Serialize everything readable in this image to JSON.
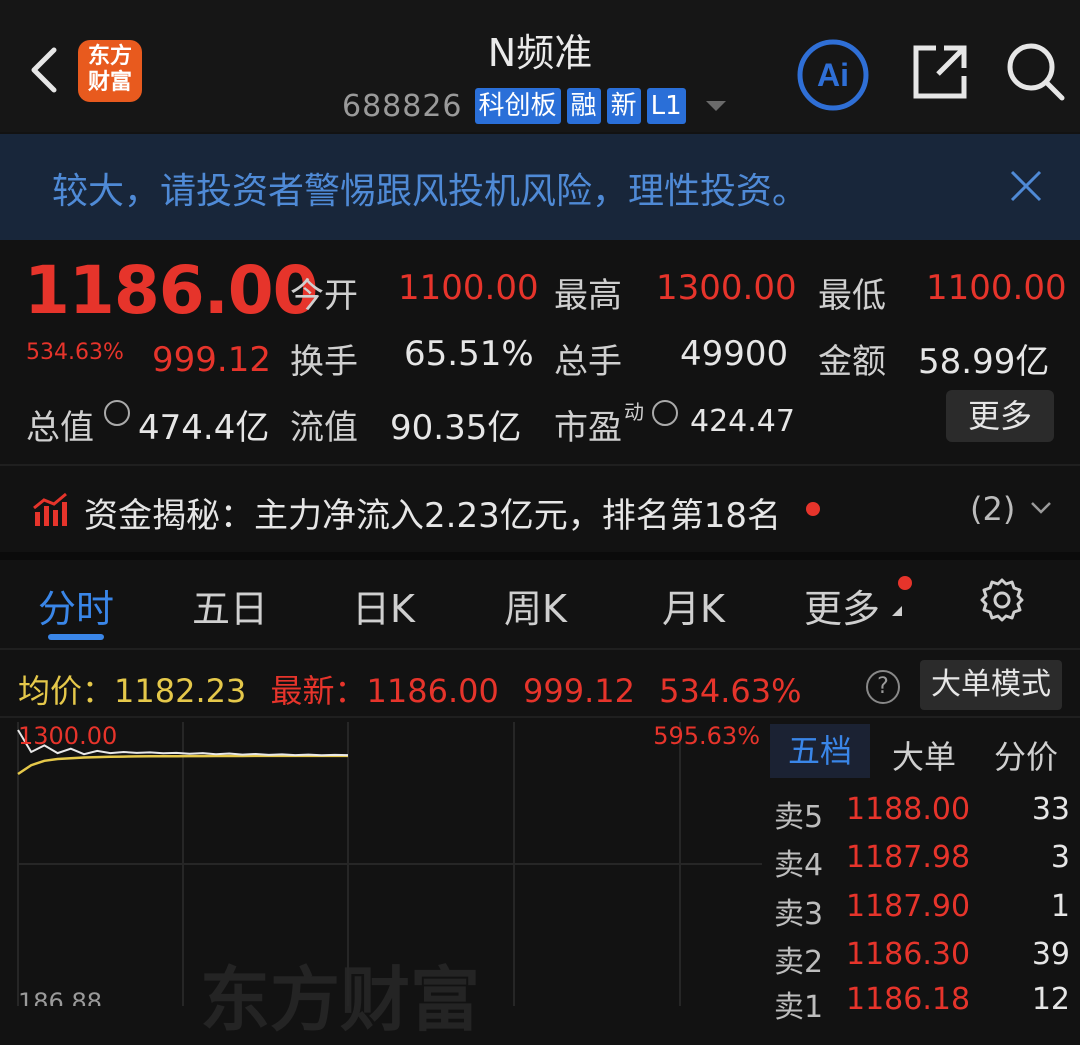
{
  "header": {
    "logo_line1": "东方",
    "logo_line2": "财富",
    "title": "N频准",
    "code": "688826",
    "tags": [
      "科创板",
      "融",
      "新",
      "L1"
    ],
    "ai_label": "Ai"
  },
  "banner": {
    "text": "较大，请投资者警惕跟风投机风险，理性投资。"
  },
  "quote": {
    "price": "1186.00",
    "pct": "534.63%",
    "change": "999.12",
    "open_label": "今开",
    "open_value": "1100.00",
    "high_label": "最高",
    "high_value": "1300.00",
    "low_label": "最低",
    "low_value": "1100.00",
    "turnover_label": "换手",
    "turnover_value": "65.51%",
    "volume_label": "总手",
    "volume_value": "49900",
    "amount_label": "金额",
    "amount_value": "58.99亿",
    "mktcap_label": "总值",
    "mktcap_value": "474.4亿",
    "float_label": "流值",
    "float_value": "90.35亿",
    "pe_label": "市盈",
    "pe_sup": "动",
    "pe_value": "424.47",
    "more_label": "更多"
  },
  "fund": {
    "text": "资金揭秘：主力净流入2.23亿元，排名第18名",
    "count": "(2)"
  },
  "tabs": [
    "分时",
    "五日",
    "日K",
    "周K",
    "月K",
    "更多"
  ],
  "avg_row": {
    "avg_label": "均价：",
    "avg_value": "1182.23",
    "latest_label": "最新：",
    "latest_price": "1186.00",
    "latest_change": "999.12",
    "latest_pct": "534.63%",
    "help": "?",
    "mode_label": "大单模式"
  },
  "chart_data": {
    "type": "line",
    "y_top_label": "1300.00",
    "y_bottom_label": "186.88",
    "pct_top_label": "595.63%",
    "ylim": [
      186.88,
      1300.0
    ],
    "series": [
      {
        "values": [
          1300,
          1200,
          1230,
          1195,
          1215,
          1190,
          1205,
          1195,
          1200,
          1196,
          1198,
          1194,
          1196,
          1192,
          1195,
          1190,
          1193,
          1188,
          1191,
          1187,
          1189,
          1186,
          1188,
          1185,
          1187,
          1186
        ]
      },
      {
        "values": [
          1100,
          1140,
          1160,
          1168,
          1172,
          1175,
          1177,
          1178,
          1179,
          1180,
          1180.5,
          1181,
          1181,
          1181.5,
          1181.5,
          1182,
          1182,
          1182,
          1182.1,
          1182.1,
          1182.2,
          1182.2,
          1182.2,
          1182.23,
          1182.23,
          1182.23
        ]
      }
    ],
    "colors": {
      "price": "#e8e8e8",
      "avg": "#e5c84a",
      "grid": "#262626"
    },
    "watermark": "东方财富"
  },
  "order_book": {
    "tabs": [
      "五档",
      "大单",
      "分价"
    ],
    "rows": [
      {
        "label": "卖5",
        "price": "1188.00",
        "vol": "33"
      },
      {
        "label": "卖4",
        "price": "1187.98",
        "vol": "3"
      },
      {
        "label": "卖3",
        "price": "1187.90",
        "vol": "1"
      },
      {
        "label": "卖2",
        "price": "1186.30",
        "vol": "39"
      },
      {
        "label": "卖1",
        "price": "1186.18",
        "vol": "12"
      }
    ]
  }
}
